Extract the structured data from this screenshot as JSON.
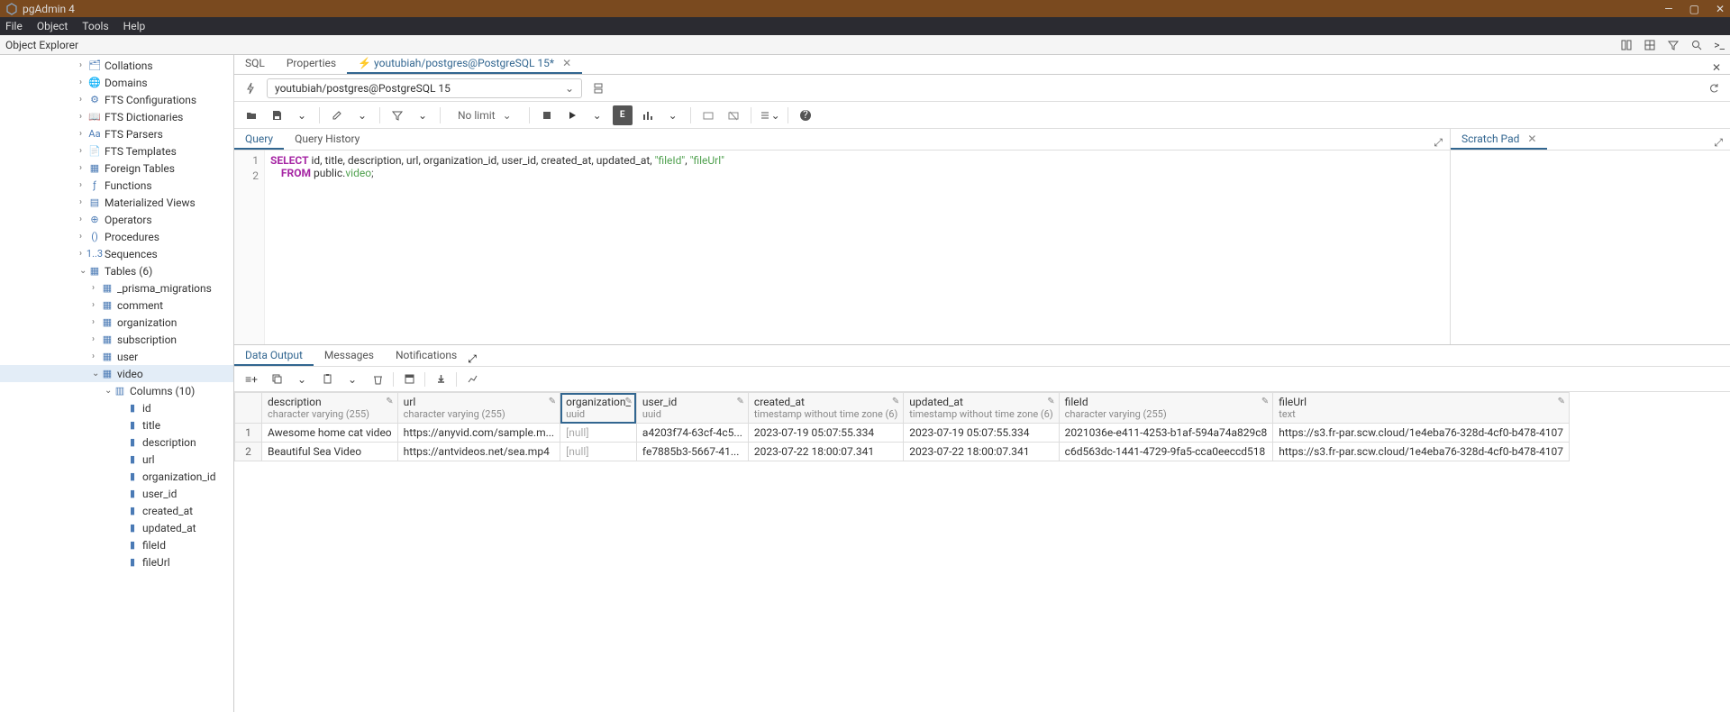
{
  "titlebar": {
    "title": "pgAdmin 4"
  },
  "menubar": [
    "File",
    "Object",
    "Tools",
    "Help"
  ],
  "explorer": {
    "title": "Object Explorer"
  },
  "tree": [
    {
      "lvl": 1,
      "chev": "›",
      "ico": "🗂",
      "label": "Collations"
    },
    {
      "lvl": 1,
      "chev": "›",
      "ico": "🌐",
      "label": "Domains"
    },
    {
      "lvl": 1,
      "chev": "›",
      "ico": "⚙",
      "label": "FTS Configurations"
    },
    {
      "lvl": 1,
      "chev": "›",
      "ico": "📖",
      "label": "FTS Dictionaries"
    },
    {
      "lvl": 1,
      "chev": "›",
      "ico": "Aa",
      "label": "FTS Parsers"
    },
    {
      "lvl": 1,
      "chev": "›",
      "ico": "📄",
      "label": "FTS Templates"
    },
    {
      "lvl": 1,
      "chev": "›",
      "ico": "▦",
      "label": "Foreign Tables"
    },
    {
      "lvl": 1,
      "chev": "›",
      "ico": "ƒ",
      "label": "Functions"
    },
    {
      "lvl": 1,
      "chev": "›",
      "ico": "▤",
      "label": "Materialized Views"
    },
    {
      "lvl": 1,
      "chev": "›",
      "ico": "⊕",
      "label": "Operators"
    },
    {
      "lvl": 1,
      "chev": "›",
      "ico": "()",
      "label": "Procedures"
    },
    {
      "lvl": 1,
      "chev": "›",
      "ico": "1..3",
      "label": "Sequences"
    },
    {
      "lvl": 1,
      "chev": "⌄",
      "ico": "▦",
      "label": "Tables (6)"
    },
    {
      "lvl": 2,
      "chev": "›",
      "ico": "▦",
      "label": "_prisma_migrations"
    },
    {
      "lvl": 2,
      "chev": "›",
      "ico": "▦",
      "label": "comment"
    },
    {
      "lvl": 2,
      "chev": "›",
      "ico": "▦",
      "label": "organization"
    },
    {
      "lvl": 2,
      "chev": "›",
      "ico": "▦",
      "label": "subscription"
    },
    {
      "lvl": 2,
      "chev": "›",
      "ico": "▦",
      "label": "user"
    },
    {
      "lvl": 2,
      "chev": "⌄",
      "ico": "▦",
      "label": "video",
      "sel": true
    },
    {
      "lvl": 3,
      "chev": "⌄",
      "ico": "▥",
      "label": "Columns (10)"
    },
    {
      "lvl": 4,
      "chev": "",
      "ico": "▮",
      "label": "id"
    },
    {
      "lvl": 4,
      "chev": "",
      "ico": "▮",
      "label": "title"
    },
    {
      "lvl": 4,
      "chev": "",
      "ico": "▮",
      "label": "description"
    },
    {
      "lvl": 4,
      "chev": "",
      "ico": "▮",
      "label": "url"
    },
    {
      "lvl": 4,
      "chev": "",
      "ico": "▮",
      "label": "organization_id"
    },
    {
      "lvl": 4,
      "chev": "",
      "ico": "▮",
      "label": "user_id"
    },
    {
      "lvl": 4,
      "chev": "",
      "ico": "▮",
      "label": "created_at"
    },
    {
      "lvl": 4,
      "chev": "",
      "ico": "▮",
      "label": "updated_at"
    },
    {
      "lvl": 4,
      "chev": "",
      "ico": "▮",
      "label": "fileId"
    },
    {
      "lvl": 4,
      "chev": "",
      "ico": "▮",
      "label": "fileUrl"
    }
  ],
  "tabs": {
    "sql": "SQL",
    "properties": "Properties",
    "query": "youtubiah/postgres@PostgreSQL 15*",
    "icon": "⚡"
  },
  "connection": {
    "value": "youtubiah/postgres@PostgreSQL 15"
  },
  "toolbar": {
    "nolimit": "No limit"
  },
  "editor_tabs": {
    "query": "Query",
    "history": "Query History"
  },
  "scratch": {
    "title": "Scratch Pad"
  },
  "sql": {
    "line1a": "SELECT",
    "line1b": " id, title, description, url, organization_id, user_id, created_at, updated_at, ",
    "line1c": "\"fileId\"",
    "line1d": ", ",
    "line1e": "\"fileUrl\"",
    "line2a": "    FROM",
    "line2b": " public.",
    "line2c": "video",
    "line2d": ";"
  },
  "output_tabs": {
    "data": "Data Output",
    "messages": "Messages",
    "notifications": "Notifications"
  },
  "grid": {
    "headers": [
      {
        "name": "description",
        "type": "character varying (255)"
      },
      {
        "name": "url",
        "type": "character varying (255)"
      },
      {
        "name": "organization_",
        "type": "uuid",
        "selected": true
      },
      {
        "name": "user_id",
        "type": "uuid"
      },
      {
        "name": "created_at",
        "type": "timestamp without time zone (6)"
      },
      {
        "name": "updated_at",
        "type": "timestamp without time zone (6)"
      },
      {
        "name": "fileId",
        "type": "character varying (255)"
      },
      {
        "name": "fileUrl",
        "type": "text"
      }
    ],
    "rows": [
      {
        "n": "1",
        "cells": [
          "Awesome home cat video",
          "https://anyvid.com/sample.m...",
          "[null]",
          "a4203f74-63cf-4c5...",
          "2023-07-19 05:07:55.334",
          "2023-07-19 05:07:55.334",
          "2021036e-e411-4253-b1af-594a74a829c8",
          "https://s3.fr-par.scw.cloud/1e4eba76-328d-4cf0-b478-4107"
        ]
      },
      {
        "n": "2",
        "cells": [
          "Beautiful Sea Video",
          "https://antvideos.net/sea.mp4",
          "[null]",
          "fe7885b3-5667-41...",
          "2023-07-22 18:00:07.341",
          "2023-07-22 18:00:07.341",
          "c6d563dc-1441-4729-9fa5-cca0eeccd518",
          "https://s3.fr-par.scw.cloud/1e4eba76-328d-4cf0-b478-4107"
        ]
      }
    ]
  }
}
